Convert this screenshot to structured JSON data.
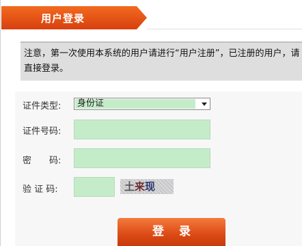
{
  "header": {
    "title": "用户登录"
  },
  "notice": {
    "text": "注意，第一次使用本系统的用户请进行“用户注册”，已注册的用户，请直接登录。"
  },
  "form": {
    "id_type_label": "证件类型:",
    "id_type_value": "身份证",
    "id_number_label": "证件号码:",
    "password_label": "密　　码:",
    "captcha_label": "验 证 码:",
    "captcha_chars": [
      "土",
      "来",
      "现"
    ]
  },
  "login_button": {
    "label": "登录"
  },
  "colors": {
    "accent": "#e85a1a",
    "field_fill": "#c5ecc9",
    "notice_bg": "#dedede"
  }
}
